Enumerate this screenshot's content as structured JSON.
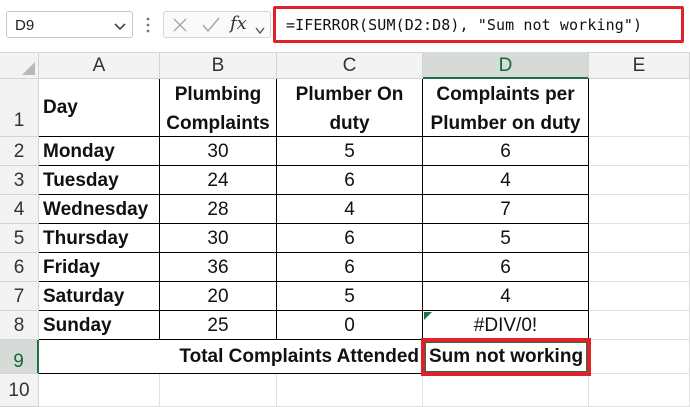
{
  "formula_bar": {
    "name_box": "D9",
    "fx_label": "fx",
    "formula": "=IFERROR(SUM(D2:D8), \"Sum not working\")"
  },
  "columns": [
    "A",
    "B",
    "C",
    "D",
    "E"
  ],
  "rows": [
    "1",
    "2",
    "3",
    "4",
    "5",
    "6",
    "7",
    "8",
    "9",
    "10"
  ],
  "headers": {
    "a": "Day",
    "b_line1": "Plumbing",
    "b_line2": "Complaints",
    "c_line1": "Plumber On",
    "c_line2": "duty",
    "d_line1": "Complaints per",
    "d_line2": "Plumber on duty"
  },
  "data_rows": [
    {
      "day": "Monday",
      "complaints": "30",
      "plumbers": "5",
      "per": "6"
    },
    {
      "day": "Tuesday",
      "complaints": "24",
      "plumbers": "6",
      "per": "4"
    },
    {
      "day": "Wednesday",
      "complaints": "28",
      "plumbers": "4",
      "per": "7"
    },
    {
      "day": "Thursday",
      "complaints": "30",
      "plumbers": "6",
      "per": "5"
    },
    {
      "day": "Friday",
      "complaints": "36",
      "plumbers": "6",
      "per": "6"
    },
    {
      "day": "Saturday",
      "complaints": "20",
      "plumbers": "5",
      "per": "4"
    },
    {
      "day": "Sunday",
      "complaints": "25",
      "plumbers": "0",
      "per": "#DIV/0!"
    }
  ],
  "total": {
    "label": "Total Complaints Attended",
    "value": "Sum not working"
  },
  "colors": {
    "highlight": "#e0202a",
    "selection": "#1e7145"
  }
}
